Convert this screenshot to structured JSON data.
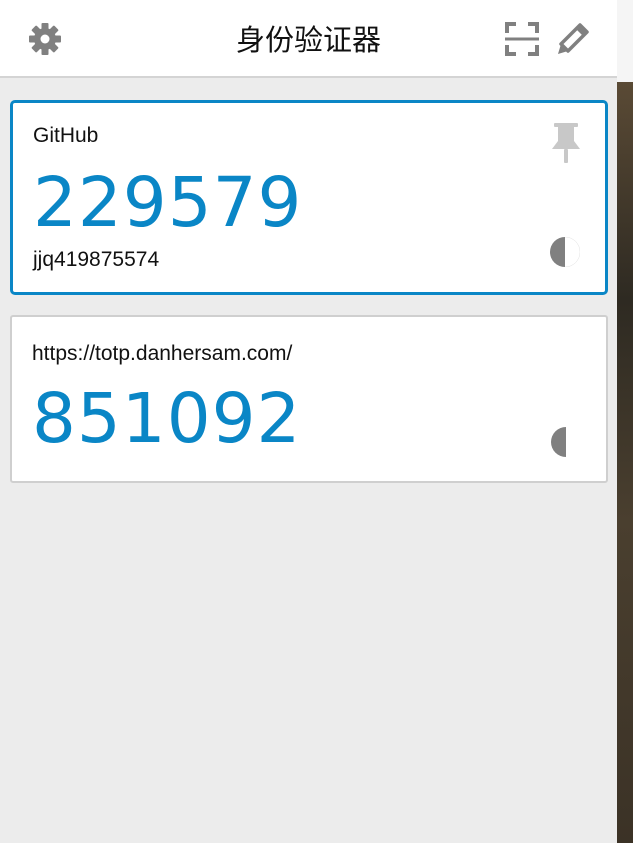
{
  "header": {
    "title": "身份验证器",
    "icons": {
      "settings": "gear-icon",
      "scan": "scan-qr-icon",
      "edit": "pencil-icon"
    }
  },
  "entries": [
    {
      "issuer": "GitHub",
      "code": "229579",
      "account": "jjq419875574",
      "selected": true,
      "pinned": true,
      "timer_remaining": 0.5
    },
    {
      "issuer": "https://totp.danhersam.com/",
      "code": "851092",
      "account": "",
      "selected": false,
      "pinned": false,
      "timer_remaining": 0.5
    }
  ],
  "colors": {
    "accent": "#0a86c6",
    "icon_gray": "#808080",
    "pin_gray": "#c8c8c8",
    "background": "#ececec"
  }
}
